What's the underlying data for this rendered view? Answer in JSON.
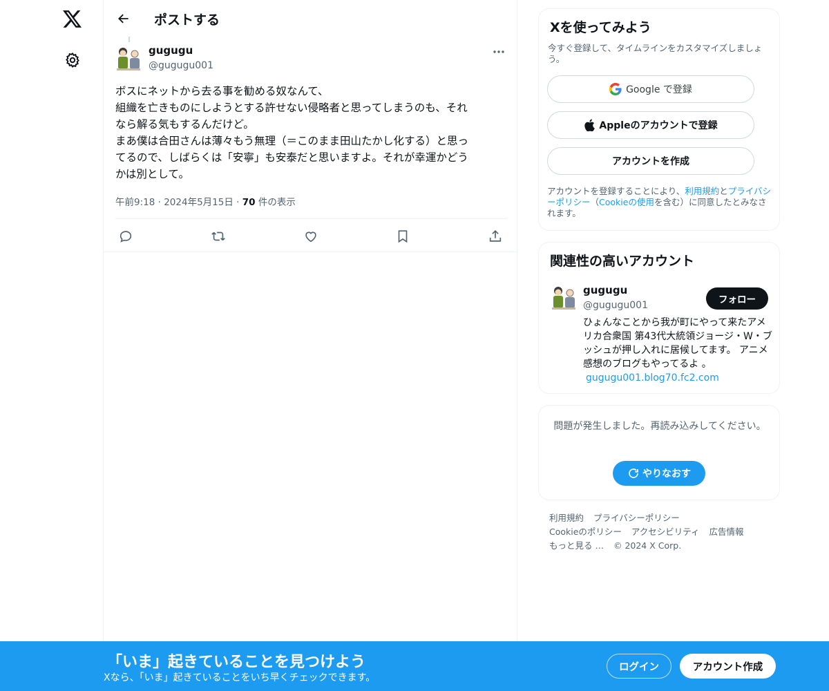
{
  "colors": {
    "accent": "#1d9bf0",
    "text": "#0f1419",
    "muted": "#536471",
    "border": "#eff3f4"
  },
  "nav": {
    "logo_icon": "x-logo-icon",
    "settings_icon": "gear-icon"
  },
  "header": {
    "back_icon": "arrow-left-icon",
    "title": "ポストする"
  },
  "post": {
    "author_name": "gugugu",
    "author_handle": "@gugugu001",
    "more_icon": "more-dots-icon",
    "text_lines": [
      "ボスにネットから去る事を勧める奴なんて、",
      "組織を亡きものにしようとする許せない侵略者と思ってしまうのも、それ",
      "なら解る気もするんだけど。",
      "まあ僕は合田さんは薄々もう無理（＝このまま田山たかし化する）と思っ",
      "てるので、しばらくは「安寧」も安泰だと思いますよ。それが幸運かどう",
      "かは別として。"
    ],
    "time": "午前9:18",
    "date": "2024年5月15日",
    "view_count": "70",
    "view_label": "件の表示",
    "actions": [
      "reply-icon",
      "repost-icon",
      "like-icon",
      "bookmark-icon",
      "share-icon"
    ]
  },
  "signup_card": {
    "title": "Xを使ってみよう",
    "subtitle": "今すぐ登録して、タイムラインをカスタマイズしましょう。",
    "google_label": "Google で登録",
    "apple_label": "Appleのアカウントで登録",
    "create_label": "アカウントを作成",
    "legal_prefix": "アカウントを登録することにより、",
    "terms_link": "利用規約",
    "legal_and": "と",
    "privacy_link": "プライバシーポリシー",
    "legal_paren_open": "（",
    "cookie_link": "Cookieの使用",
    "legal_suffix": "を含む）に同意したとみなされます。"
  },
  "related_card": {
    "title": "関連性の高いアカウント",
    "name": "gugugu",
    "handle": "@gugugu001",
    "follow_label": "フォロー",
    "bio": "ひょんなことから我が町にやって来たアメリカ合衆国 第43代大統領ジョージ・W・ブッシュが押し入れに居候してます。 アニメ感想のブログもやってるよ 。",
    "bio_link": "gugugu001.blog70.fc2.com"
  },
  "error_card": {
    "message": "問題が発生しました。再読み込みしてください。",
    "retry_label": "やりなおす"
  },
  "footer": {
    "links": [
      "利用規約",
      "プライバシーポリシー",
      "Cookieのポリシー",
      "アクセシビリティ",
      "広告情報",
      "もっと見る …"
    ],
    "copyright": "© 2024 X Corp."
  },
  "bottom_bar": {
    "title": "「いま」起きていることを見つけよう",
    "subtitle": "Xなら、「いま」起きていることをいち早くチェックできます。",
    "login_label": "ログイン",
    "signup_label": "アカウント作成"
  }
}
